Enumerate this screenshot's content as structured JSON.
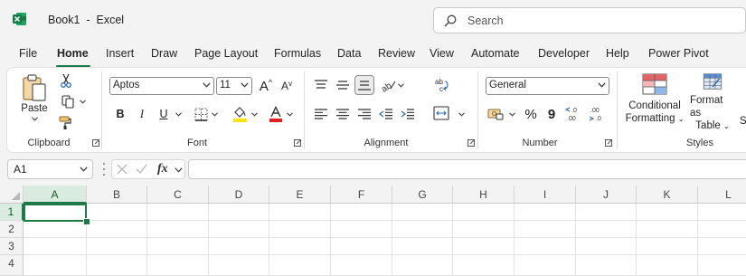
{
  "window": {
    "title": "Book1  -  Excel"
  },
  "search": {
    "placeholder": "Search"
  },
  "menu": [
    "File",
    "Home",
    "Insert",
    "Draw",
    "Page Layout",
    "Formulas",
    "Data",
    "Review",
    "View",
    "Automate",
    "Developer",
    "Help",
    "Power Pivot"
  ],
  "active_tab": "Home",
  "ribbon": {
    "clipboard": {
      "label": "Clipboard",
      "paste": "Paste"
    },
    "font": {
      "label": "Font",
      "font_name": "Aptos",
      "font_size": "11",
      "grow": "A",
      "shrink": "A",
      "bold": "B",
      "italic": "I",
      "underline": "U",
      "highlight_color": "#ffe600",
      "font_color": "#e02020"
    },
    "alignment": {
      "label": "Alignment"
    },
    "number": {
      "label": "Number",
      "format": "General",
      "percent": "%",
      "comma": "9"
    },
    "styles": {
      "label": "Styles",
      "conditional_line1": "Conditional",
      "conditional_line2": "Formatting",
      "table_line1": "Format as",
      "table_line2": "Table",
      "cell_styles_partial": "S"
    }
  },
  "formula_bar": {
    "name_box": "A1",
    "fx": "fx",
    "value": ""
  },
  "sheet": {
    "columns": [
      "A",
      "B",
      "C",
      "D",
      "E",
      "F",
      "G",
      "H",
      "I",
      "J",
      "K",
      "L"
    ],
    "rows": [
      "1",
      "2",
      "3",
      "4"
    ],
    "active_cell": "A1"
  },
  "colors": {
    "accent": "#1d7a46",
    "excel_green": "#107c41"
  }
}
